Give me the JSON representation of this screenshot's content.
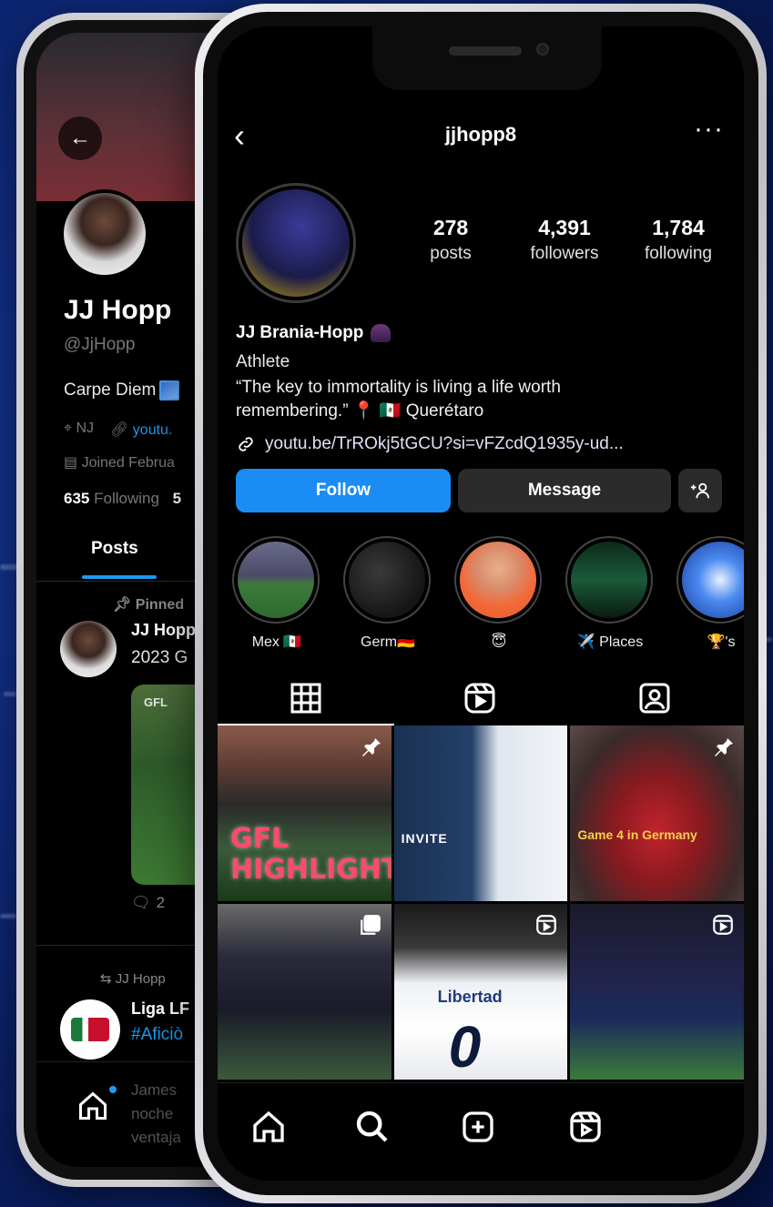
{
  "twitter": {
    "name": "JJ Hopp",
    "handle": "@JjHopp",
    "bio": "Carpe Diem",
    "location": "NJ",
    "link": "youtu.",
    "joined": "Joined Februa",
    "following_count": "635",
    "following_label": "Following",
    "followers_partial": "5",
    "tab_posts": "Posts",
    "pinned_label": "Pinned",
    "tweet_author": "JJ Hopp",
    "tweet_text": "2023 G",
    "media_tag": "GFL",
    "reply_count": "2",
    "repost_label": "JJ Hopp",
    "liga_name": "Liga LF",
    "liga_tag": "#Aficiò",
    "faded_line1": "James",
    "faded_line2": "noche",
    "faded_line3": "ventaja"
  },
  "instagram": {
    "username": "jjhopp8",
    "stats": [
      {
        "num": "278",
        "label": "posts"
      },
      {
        "num": "4,391",
        "label": "followers"
      },
      {
        "num": "1,784",
        "label": "following"
      }
    ],
    "full_name": "JJ Brania-Hopp",
    "category": "Athlete",
    "bio_line1": "“The key to immortality is living a life worth",
    "bio_line2": "remembering.” 📍 🇲🇽 Querétaro",
    "link": "youtu.be/TrROkj5tGCU?si=vFZcdQ1935y-ud...",
    "follow_label": "Follow",
    "message_label": "Message",
    "add_user_label": "+⁠👤",
    "highlights": [
      {
        "label": "Mex 🇲🇽"
      },
      {
        "label": "Germ🇩🇪"
      },
      {
        "label": "😇"
      },
      {
        "label": "✈️ Places"
      },
      {
        "label": "🏆's"
      }
    ],
    "grid_text": {
      "gfl_line1": "GFL",
      "gfl_line2": "HIGHLIGHTS",
      "invite": "INVITE",
      "game4": "Game 4 in Germany",
      "libertad": "Libertad",
      "jersey": "0"
    }
  },
  "colors": {
    "follow_blue": "#1b8cf4",
    "twitter_blue": "#1d9bf0",
    "background": "#0f2a7d"
  },
  "icons": {
    "grid": "grid-icon",
    "reels": "reels-icon",
    "tagged": "tagged-icon",
    "home": "home-icon",
    "search": "search-icon",
    "add": "add-post-icon",
    "reels_nav": "reels-nav-icon"
  }
}
